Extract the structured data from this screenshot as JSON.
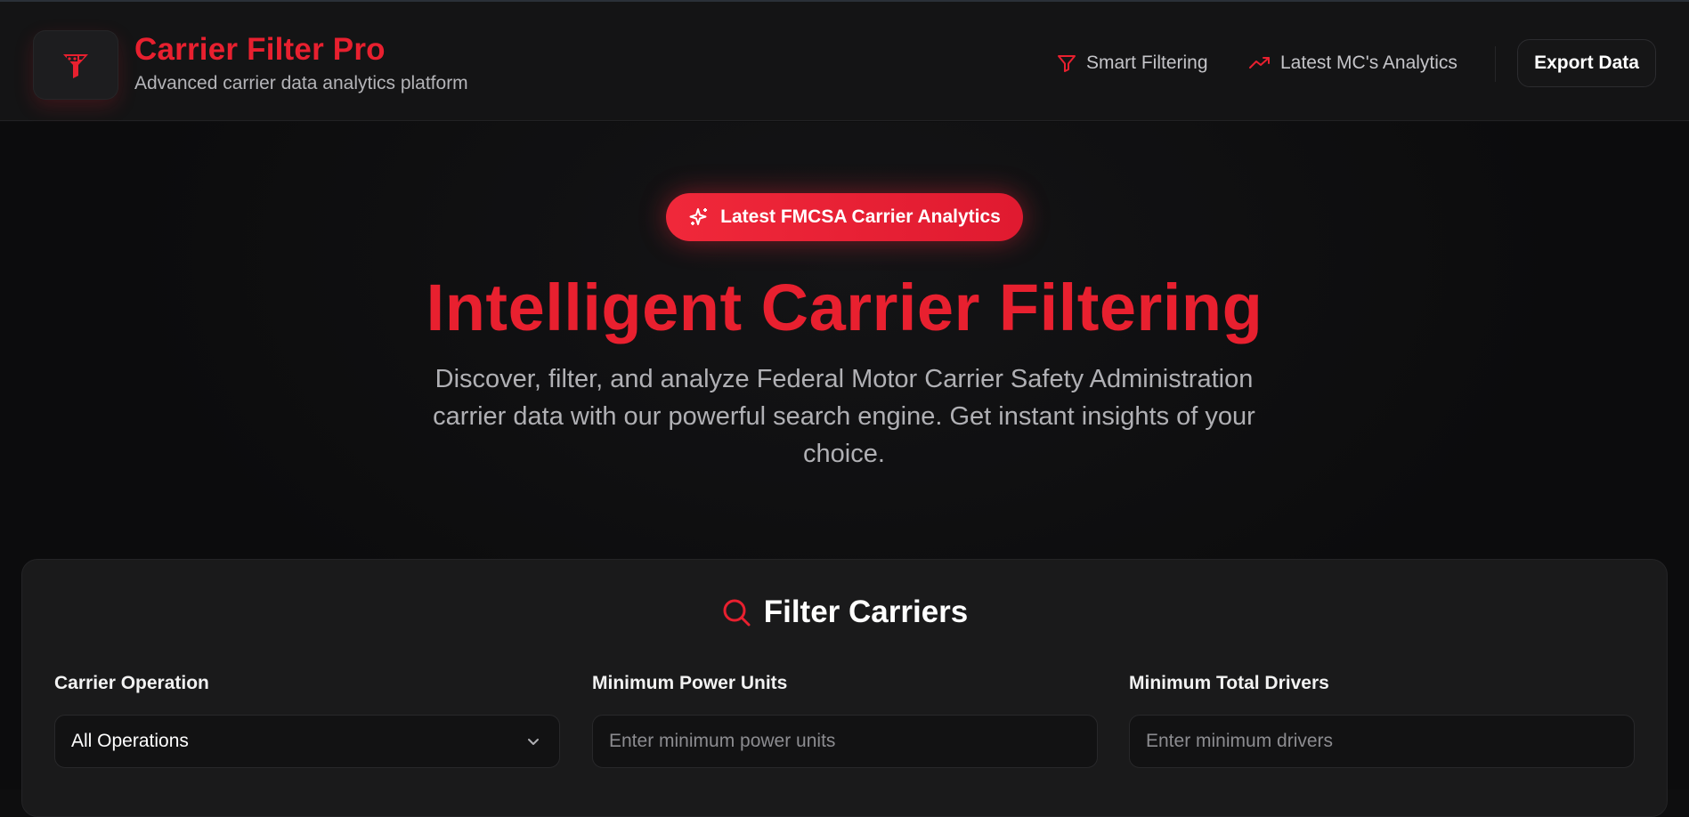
{
  "header": {
    "brand_title": "Carrier Filter Pro",
    "brand_subtitle": "Advanced carrier data analytics platform",
    "nav": [
      {
        "label": "Smart Filtering",
        "icon": "filter-icon"
      },
      {
        "label": "Latest MC's Analytics",
        "icon": "trending-up-icon"
      }
    ],
    "export_label": "Export Data"
  },
  "hero": {
    "badge_label": "Latest FMCSA Carrier Analytics",
    "badge_icon": "sparkles-icon",
    "title": "Intelligent Carrier Filtering",
    "description": "Discover, filter, and analyze Federal Motor Carrier Safety Administration carrier data with our powerful search engine. Get instant insights of your choice."
  },
  "filters": {
    "title": "Filter Carriers",
    "title_icon": "search-icon",
    "carrier_operation": {
      "label": "Carrier Operation",
      "value": "All Operations"
    },
    "min_power_units": {
      "label": "Minimum Power Units",
      "placeholder": "Enter minimum power units"
    },
    "min_total_drivers": {
      "label": "Minimum Total Drivers",
      "placeholder": "Enter minimum drivers"
    }
  },
  "colors": {
    "accent": "#e8202f",
    "background": "#0e0e0f",
    "panel": "#1a1a1b"
  }
}
